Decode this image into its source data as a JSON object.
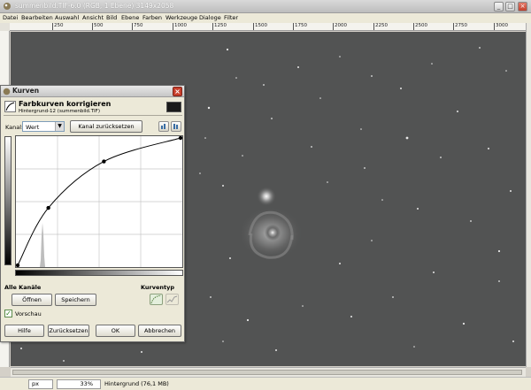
{
  "window": {
    "title": "summenbild.TIF-6.0 (RGB, 1 Ebene) 3149x2058",
    "minimize": "_",
    "maximize": "□",
    "close": "×"
  },
  "menu": [
    "Datei",
    "Bearbeiten",
    "Auswahl",
    "Ansicht",
    "Bild",
    "Ebene",
    "Farben",
    "Werkzeuge",
    "Dialoge",
    "Filter"
  ],
  "ruler": {
    "ticks": [
      "250",
      "500",
      "750",
      "1000",
      "1250",
      "1500",
      "1750",
      "2000",
      "2250",
      "2500",
      "2750",
      "3000"
    ]
  },
  "status": {
    "unit": "px",
    "zoom": "33%",
    "info": "Hintergrund (76,1 MB)"
  },
  "dialog": {
    "title": "Kurven",
    "close": "×",
    "header_title": "Farbkurven korrigieren",
    "header_subtitle": "Hintergrund-12 (summenbild.TIF)",
    "channel_label": "Kanal:",
    "channel_value": "Wert",
    "reset_channel": "Kanal zurücksetzen",
    "all_channels": "Alle Kanäle",
    "curve_type": "Kurventyp",
    "open": "Öffnen",
    "save": "Speichern",
    "preview": "Vorschau",
    "help": "Hilfe",
    "reset": "Zurücksetzen",
    "ok": "OK",
    "cancel": "Abbrechen"
  },
  "curve": {
    "x_range": [
      0,
      255
    ],
    "y_range": [
      0,
      255
    ],
    "control_points": [
      [
        0,
        0
      ],
      [
        48,
        115
      ],
      [
        135,
        208
      ],
      [
        255,
        255
      ]
    ]
  },
  "colors": {
    "canvas_background": "#525353",
    "dialog_background": "#ece9d8",
    "close_button": "#c8402d"
  }
}
